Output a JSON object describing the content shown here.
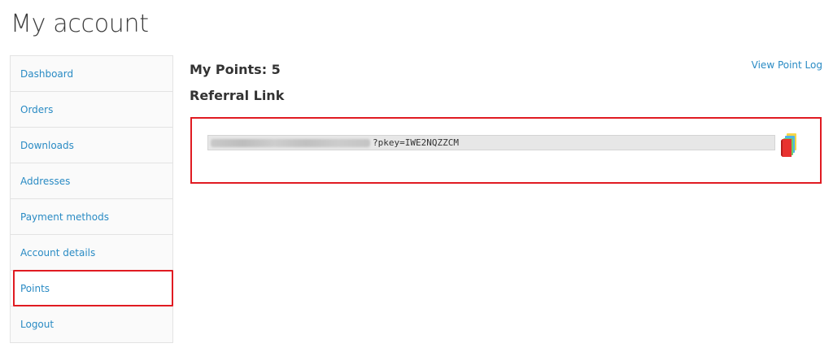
{
  "page": {
    "title": "My account"
  },
  "sidebar": {
    "items": [
      {
        "label": "Dashboard"
      },
      {
        "label": "Orders"
      },
      {
        "label": "Downloads"
      },
      {
        "label": "Addresses"
      },
      {
        "label": "Payment methods"
      },
      {
        "label": "Account details"
      },
      {
        "label": "Points"
      },
      {
        "label": "Logout"
      }
    ],
    "active": "Points"
  },
  "main": {
    "points_label": "My Points:",
    "points_value": "5",
    "view_log_label": "View Point Log",
    "referral_heading": "Referral Link",
    "referral_url_suffix": "?pkey=IWE2NQZZCM",
    "copy_icon": "copy-clipboard-icon"
  },
  "colors": {
    "link": "#2a8bc4",
    "highlight_border": "#e01b22",
    "input_bg": "#e7e7e7",
    "sidebar_bg": "#fafafa"
  }
}
